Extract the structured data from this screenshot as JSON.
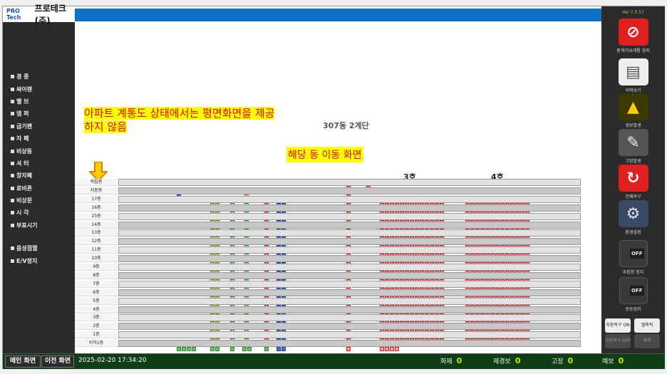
{
  "app": {
    "logo_mark": "PRO Tech",
    "name": "프로테크(주)",
    "version": "Ver 7.5.57"
  },
  "sidebar": {
    "items": [
      "경 종",
      "싸이렌",
      "밸 브",
      "댐 퍼",
      "급기팬",
      "자 폐",
      "비상등",
      "셔 터",
      "창자폐",
      "로비폰",
      "비상문",
      "시 각",
      "부표시기",
      "음성점멸",
      "E/V정지"
    ]
  },
  "annotation": {
    "line1": "아파트 계통도 상태에서는 평면화면을 제공",
    "line2": "하지 않음",
    "move": "해당 동 이동 화면"
  },
  "building": {
    "title": "307동 2계단",
    "ho": [
      "3호",
      "4호"
    ]
  },
  "floors": [
    "옥탑층",
    "지붕층",
    "17층",
    "16층",
    "15층",
    "14층",
    "13층",
    "12층",
    "11층",
    "10층",
    "9층",
    "8층",
    "7층",
    "6층",
    "5층",
    "4층",
    "3층",
    "2층",
    "1층",
    "지하1층"
  ],
  "right": {
    "b1": "중계기(6개통 정지",
    "b2": "이력보기",
    "b3": "경보발생",
    "b4": "고장발생",
    "b5": "전체복구",
    "b6": "환경설정",
    "sw1_state": "OFF",
    "sw1_label": "주음향 정지",
    "sw2_state": "OFF",
    "sw2_label": "방송정지",
    "auto_on": "자동복구 ON",
    "bell": "벨축적",
    "auto_off": "자동복구 OFF",
    "save": "축적"
  },
  "bottom": {
    "main": "메인 화면",
    "prev": "이전 화면",
    "datetime": "2025-02-20 17:34:20",
    "fire_label": "화재",
    "fire": "0",
    "alarm_label": "제경보",
    "alarm": "0",
    "fault_label": "고장",
    "fault": "0",
    "pre_label": "예보",
    "pre": "0"
  },
  "colors": {
    "accent": "#0b72c6",
    "alert": "#e00000",
    "highlight": "#ffff00",
    "bottom_bg": "#0f3d16"
  }
}
